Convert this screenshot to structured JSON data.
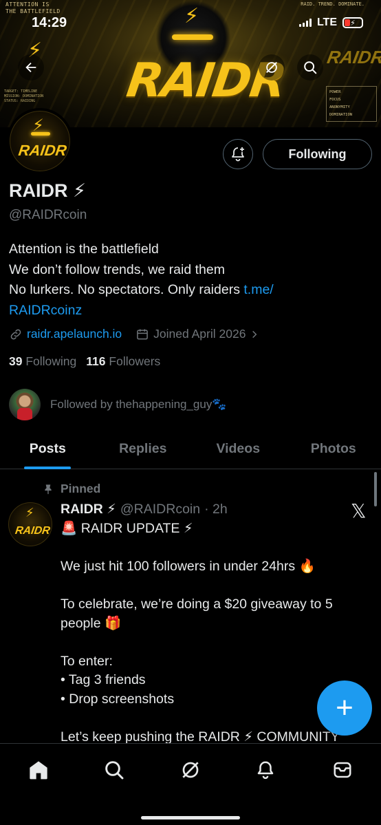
{
  "status_bar": {
    "time": "14:29",
    "network": "LTE",
    "battery_level": "low",
    "battery_color": "#ff3b30"
  },
  "banner": {
    "corner_left": "ATTENTION IS\nTHE BATTLEFIELD",
    "corner_right": "RAID. TREND. DOMINATE.",
    "logo_text": "RAIDR",
    "small_left": "TARGET: TIMELINE\nMISSION: DOMINATION\nSTATUS: RAIDING",
    "stats": [
      "POWER",
      "FOCUS",
      "ANONYMITY",
      "DOMINATION"
    ]
  },
  "header_icons": {
    "back": "arrow-left-icon",
    "grok": "grok-icon",
    "search": "search-icon"
  },
  "profile": {
    "avatar_text": "RAIDR",
    "notify_icon": "bell-plus-icon",
    "following_label": "Following",
    "name": "RAIDR ⚡",
    "handle": "@RAIDRcoin",
    "bio_line1": "Attention is the battlefield",
    "bio_line2": "We don’t follow trends, we raid them",
    "bio_line3": "No lurkers. No spectators. Only raiders ",
    "bio_link_part1": "t.me/",
    "bio_link_part2": "RAIDRcoinz",
    "website": "raidr.apelaunch.io",
    "joined": "Joined April 2026",
    "following_count": "39",
    "following_label_text": "Following",
    "followers_count": "116",
    "followers_label_text": "Followers",
    "followed_by": "Followed by thehappening_guy🐾"
  },
  "tabs": [
    "Posts",
    "Replies",
    "Videos",
    "Photos"
  ],
  "active_tab": "Posts",
  "post": {
    "pinned_label": "Pinned",
    "author_name": "RAIDR ⚡",
    "author_handle": "@RAIDRcoin",
    "time": "· 2h",
    "avatar_text": "RAIDR",
    "lines": [
      "🚨 RAIDR UPDATE ⚡",
      "",
      "We just hit 100 followers in under 24hrs 🔥",
      "",
      "To celebrate, we’re doing a $20 giveaway to 5",
      "people 🎁",
      "",
      "To enter:",
      "• Tag 3 friends",
      "• Drop screenshots",
      "",
      "Let’s keep pushing the RAIDR ⚡ COMMUNITY"
    ]
  },
  "fab_label": "+",
  "bottom_nav": [
    "home-icon",
    "search-icon",
    "grok-icon",
    "notifications-icon",
    "messages-icon"
  ],
  "colors": {
    "accent": "#1d9bf0",
    "brand_yellow": "#f6c21a",
    "muted": "#71767b"
  }
}
